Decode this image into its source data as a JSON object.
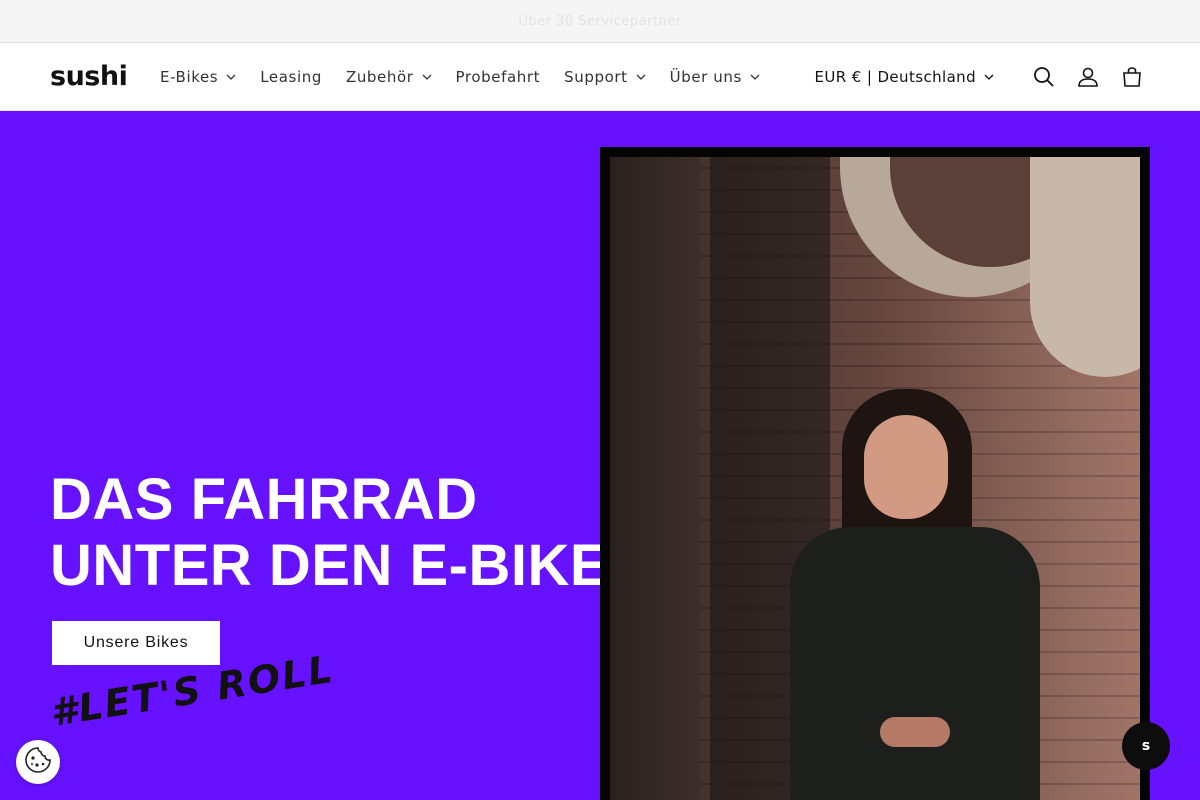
{
  "announcement": {
    "text": "Über 30 Servicepartner"
  },
  "header": {
    "logo": "sushi",
    "nav": [
      {
        "label": "E-Bikes",
        "has_dropdown": true
      },
      {
        "label": "Leasing",
        "has_dropdown": false
      },
      {
        "label": "Zubehör",
        "has_dropdown": true
      },
      {
        "label": "Probefahrt",
        "has_dropdown": false
      },
      {
        "label": "Support",
        "has_dropdown": true
      },
      {
        "label": "Über uns",
        "has_dropdown": true
      }
    ],
    "locale": "EUR € | Deutschland",
    "icons": [
      "search-icon",
      "account-icon",
      "cart-icon"
    ]
  },
  "hero": {
    "title_line1": "DAS FAHRRAD",
    "title_line2": "UNTER DEN E-BIKES",
    "button_label": "Unsere Bikes",
    "hashtag": "#LET'S ROLL",
    "background_color": "#6611ff"
  },
  "widgets": {
    "chat_label": "s",
    "cookie_icon": "cookie-icon"
  }
}
